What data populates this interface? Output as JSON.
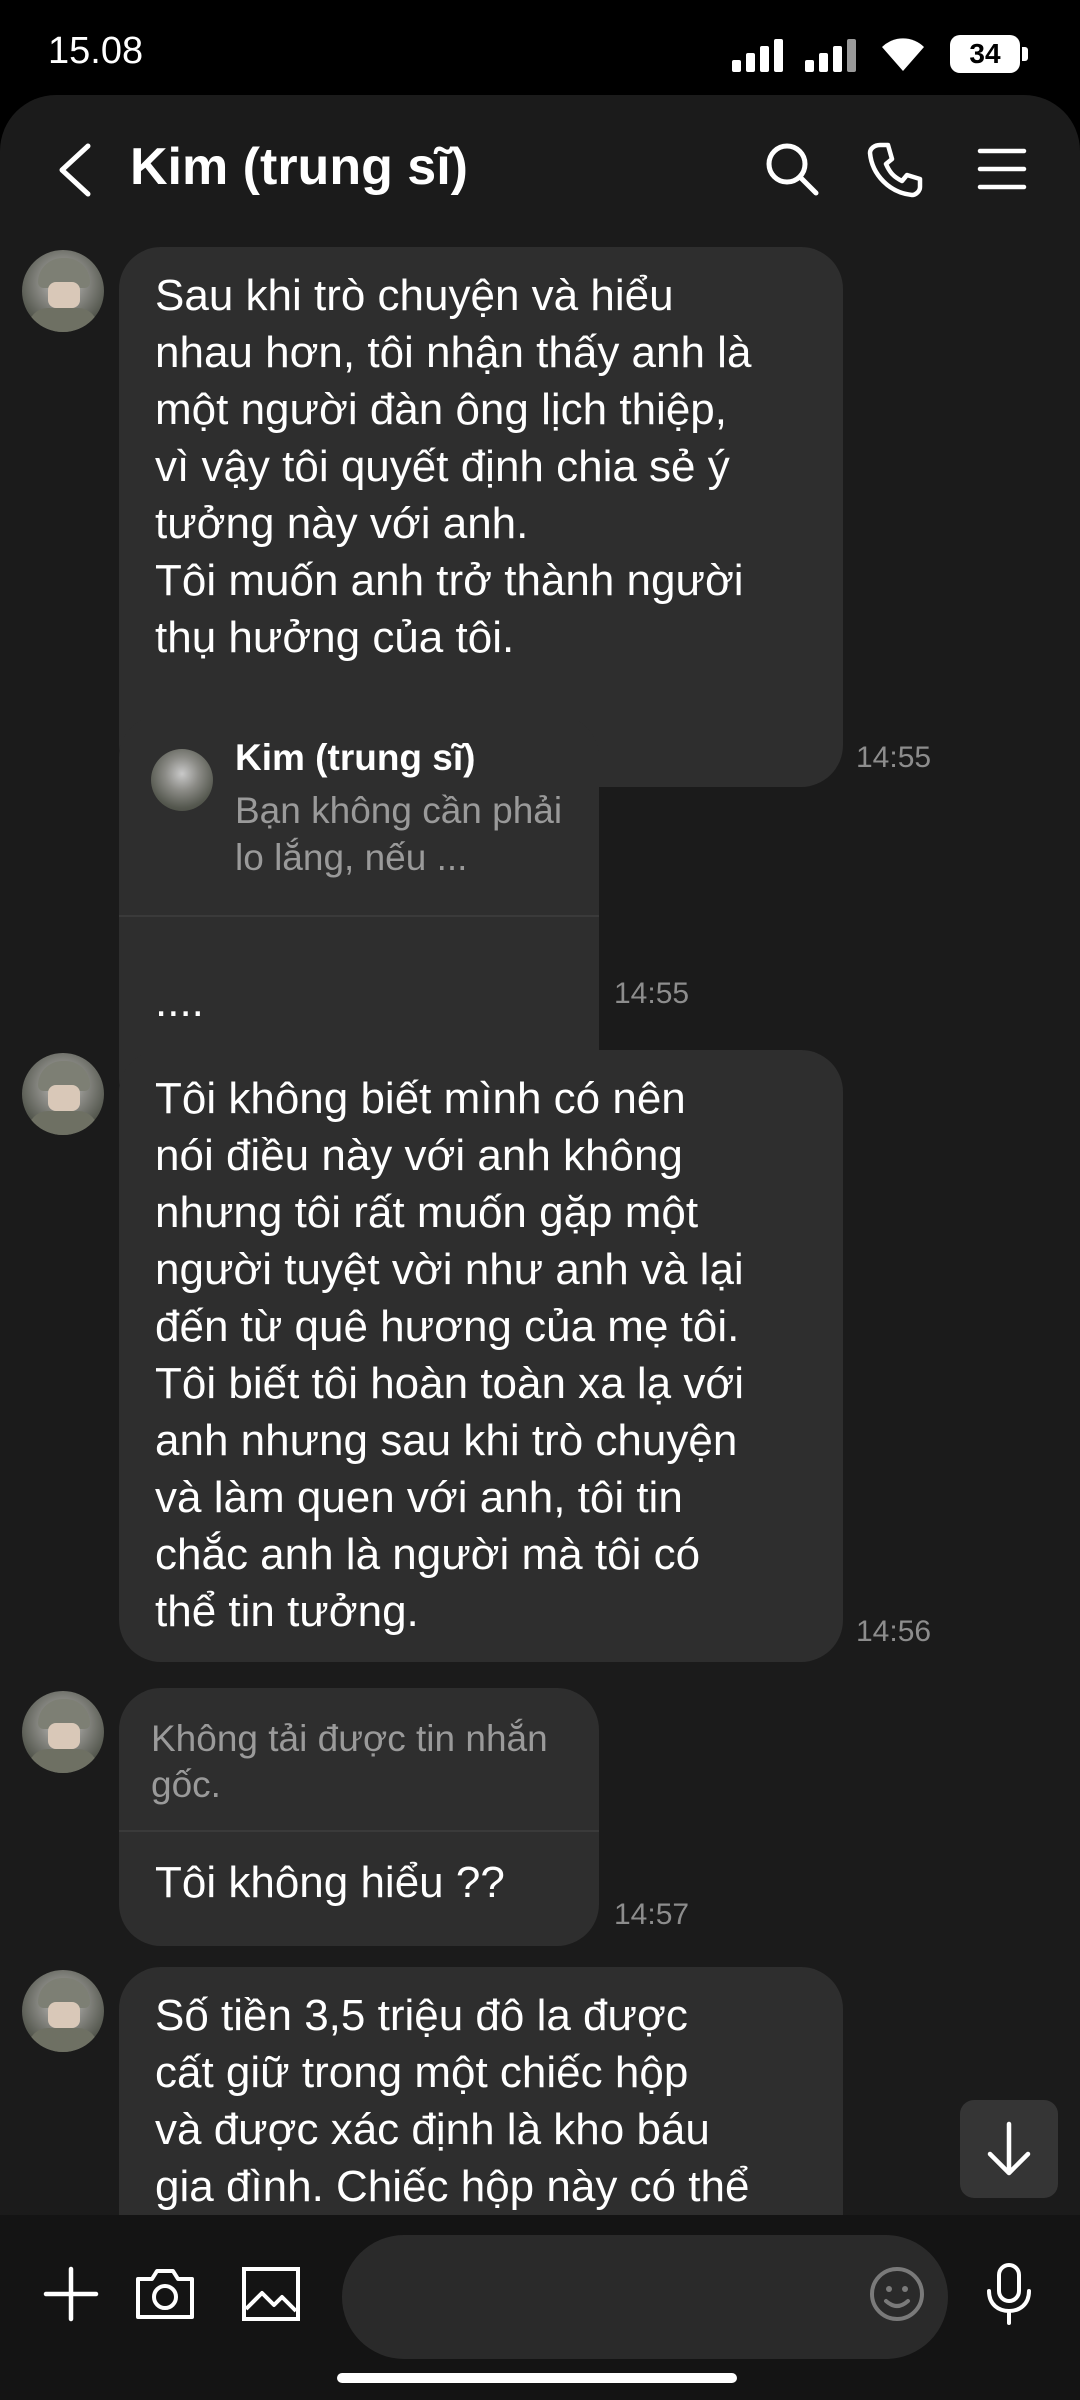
{
  "status_bar": {
    "time": "15.08",
    "battery": "34"
  },
  "header": {
    "title": "Kim (trung sĩ)",
    "icons": [
      "back-icon",
      "search-icon",
      "phone-icon",
      "menu-icon"
    ]
  },
  "messages": [
    {
      "text": "Sau khi trò chuyện và hiểu\nnhau hơn, tôi nhận thấy anh là\nmột người đàn ông lịch thiệp,\nvì vậy tôi quyết định chia sẻ ý\ntưởng này với anh.\nTôi muốn anh trở thành người\nthụ hưởng của tôi.",
      "time": "14:55"
    },
    {
      "quote_name": "Kim (trung sĩ)",
      "quote_preview": "Bạn không cần phải lo lắng, nếu ...",
      "text": "....",
      "time": "14:55"
    },
    {
      "text": "Tôi không biết mình có nên\nnói điều này với anh không\nnhưng tôi rất muốn gặp một\nngười tuyệt vời như anh và lại\nđến từ quê hương của mẹ tôi.\nTôi biết tôi hoàn toàn xa lạ với\nanh nhưng sau khi trò chuyện\nvà làm quen với anh, tôi tin\nchắc anh là người mà tôi có\nthể tin tưởng.",
      "time": "14:56"
    },
    {
      "notice": "Không tải được tin nhắn gốc.",
      "text": "Tôi không hiểu ??",
      "time": "14:57"
    },
    {
      "text": "Số tiền 3,5 triệu đô la được\ncất giữ trong một chiếc hộp\nvà được xác định là kho báu\ngia đình. Chiếc hộp này có thể"
    }
  ],
  "input": {
    "placeholder": ""
  },
  "colors": {
    "panel_bg": "#1b1b1b",
    "bubble_bg": "#2e2e2e",
    "timestamp": "#8d8d8d"
  }
}
